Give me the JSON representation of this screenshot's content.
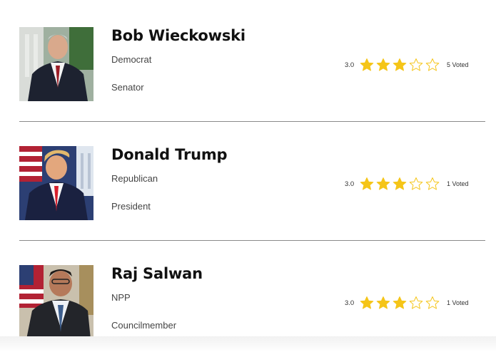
{
  "candidates": [
    {
      "name": "Bob Wieckowski",
      "party": "Democrat",
      "office": "Senator",
      "score": "3.0",
      "rating": 3,
      "max_rating": 5,
      "votes": "5 Voted"
    },
    {
      "name": "Donald Trump",
      "party": "Republican",
      "office": "President",
      "score": "3.0",
      "rating": 3,
      "max_rating": 5,
      "votes": "1 Voted"
    },
    {
      "name": "Raj Salwan",
      "party": "NPP",
      "office": "Councilmember",
      "score": "3.0",
      "rating": 3,
      "max_rating": 5,
      "votes": "1 Voted"
    }
  ],
  "colors": {
    "star_filled": "#f5c518",
    "star_empty_stroke": "#f5c518",
    "divider": "#8a8a8a"
  },
  "icons": {
    "filled": "star-filled-icon",
    "empty": "star-outline-icon"
  }
}
